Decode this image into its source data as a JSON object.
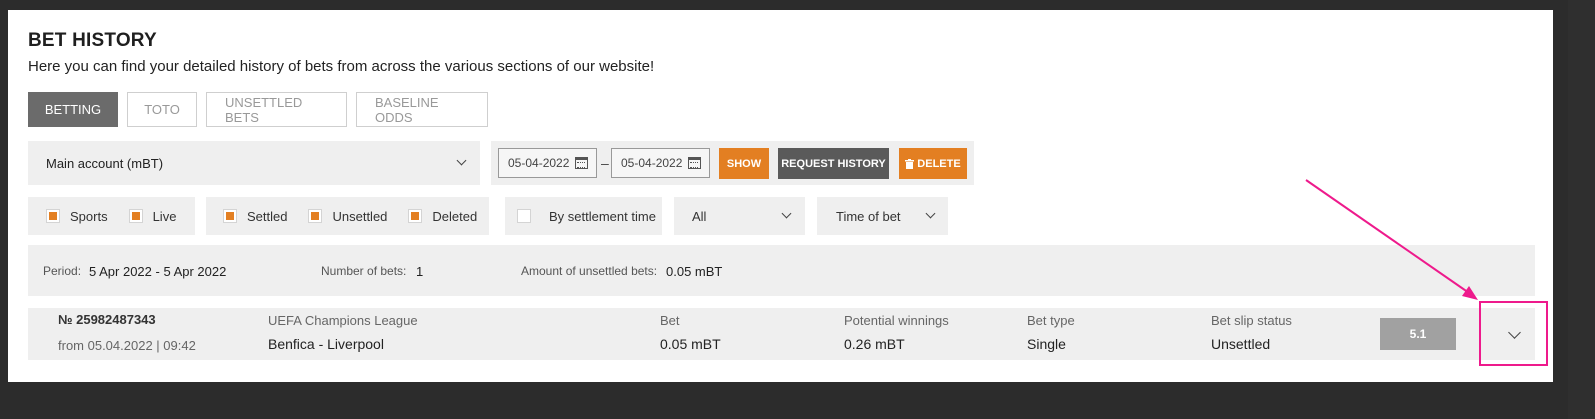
{
  "header": {
    "title": "BET HISTORY",
    "subtitle": "Here you can find your detailed history of bets from across the various sections of our website!"
  },
  "tabs": [
    {
      "label": "BETTING",
      "active": true
    },
    {
      "label": "TOTO",
      "active": false
    },
    {
      "label": "UNSETTLED BETS",
      "active": false
    },
    {
      "label": "BASELINE ODDS",
      "active": false
    }
  ],
  "account": {
    "selected": "Main account (mBT)"
  },
  "dates": {
    "from": "05-04-2022",
    "to": "05-04-2022",
    "separator": "–"
  },
  "buttons": {
    "show": "SHOW",
    "request_history": "REQUEST HISTORY",
    "delete": "DELETE"
  },
  "filters": {
    "sports": "Sports",
    "live": "Live",
    "settled": "Settled",
    "unsettled": "Unsettled",
    "deleted": "Deleted",
    "by_settlement_time": "By settlement time",
    "type_select": "All",
    "time_select": "Time of bet"
  },
  "summary": {
    "period_label": "Period:",
    "period_value": "5 Apr 2022 - 5 Apr 2022",
    "count_label": "Number of bets:",
    "count_value": "1",
    "unsettled_label": "Amount of unsettled bets:",
    "unsettled_value": "0.05 mBT"
  },
  "bet": {
    "number": "№ 25982487343",
    "date": "from 05.04.2022 | 09:42",
    "league": "UEFA Champions League",
    "match": "Benfica - Liverpool",
    "bet_label": "Bet",
    "bet_value": "0.05 mBT",
    "winnings_label": "Potential winnings",
    "winnings_value": "0.26 mBT",
    "type_label": "Bet type",
    "type_value": "Single",
    "status_label": "Bet slip status",
    "status_value": "Unsettled",
    "odds": "5.1"
  },
  "colors": {
    "accent": "#e37f22",
    "highlight": "#ee1a8c",
    "active_tab": "#6b6b6b"
  },
  "icons": [
    "chevron-down-icon",
    "calendar-icon",
    "trash-icon",
    "arrow-annotation"
  ]
}
